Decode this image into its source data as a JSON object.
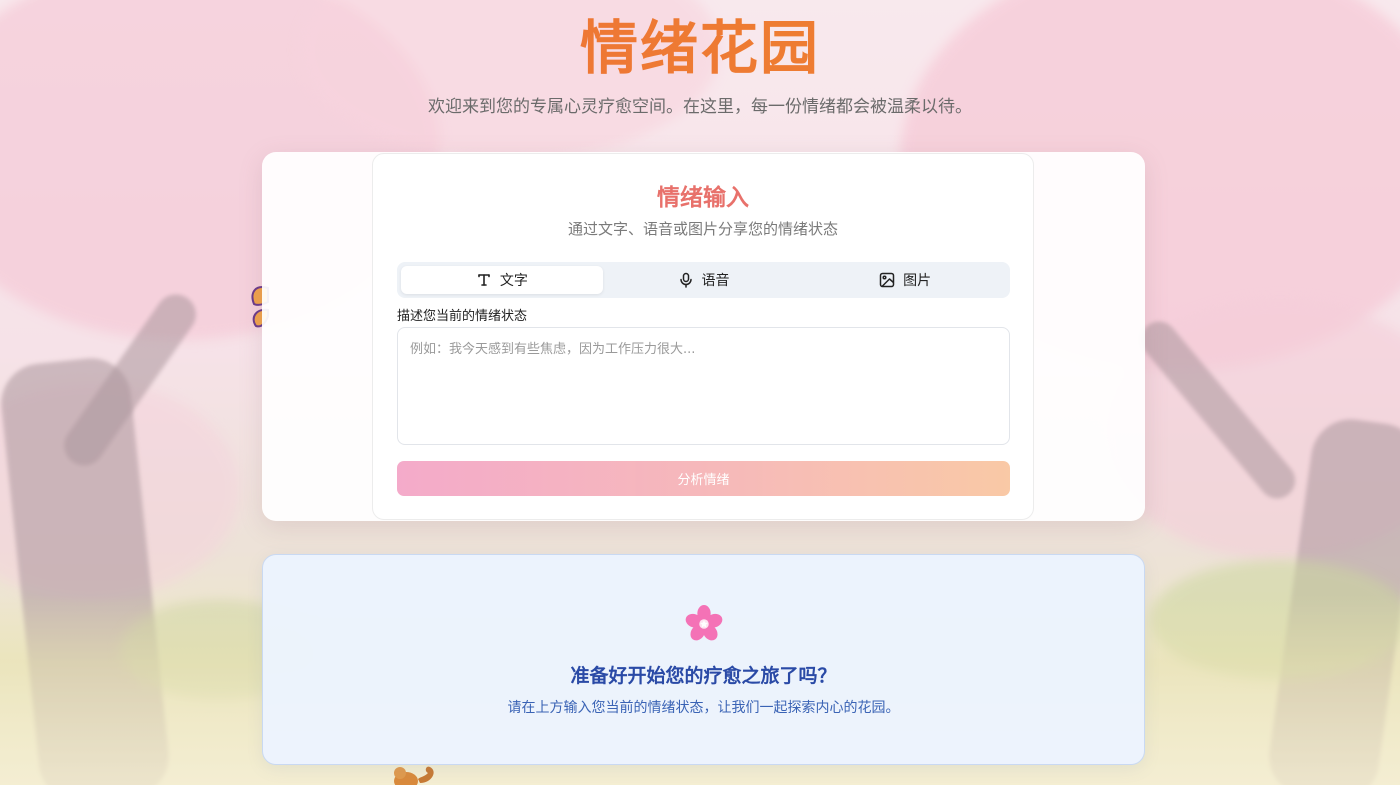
{
  "header": {
    "title": "情绪花园",
    "subtitle": "欢迎来到您的专属心灵疗愈空间。在这里，每一份情绪都会被温柔以待。"
  },
  "input_card": {
    "title": "情绪输入",
    "subtitle": "通过文字、语音或图片分享您的情绪状态",
    "tabs": [
      {
        "label": "文字",
        "icon": "text-icon",
        "active": true
      },
      {
        "label": "语音",
        "icon": "microphone-icon",
        "active": false
      },
      {
        "label": "图片",
        "icon": "image-icon",
        "active": false
      }
    ],
    "field_label": "描述您当前的情绪状态",
    "textarea_value": "",
    "textarea_placeholder": "例如：我今天感到有些焦虑，因为工作压力很大...",
    "submit_label": "分析情绪"
  },
  "welcome_card": {
    "icon": "cherry-blossom-icon",
    "title": "准备好开始您的疗愈之旅了吗？",
    "text": "请在上方输入您当前的情绪状态，让我们一起探索内心的花园。"
  },
  "colors": {
    "title_gradient": [
      "#ec6a3c",
      "#f08a2a"
    ],
    "card_title": "#e8716b",
    "button_gradient": [
      "#f3a6c7",
      "#f9c6a1"
    ],
    "welcome_title": "#2a4aa6",
    "welcome_text": "#3a63b5"
  }
}
